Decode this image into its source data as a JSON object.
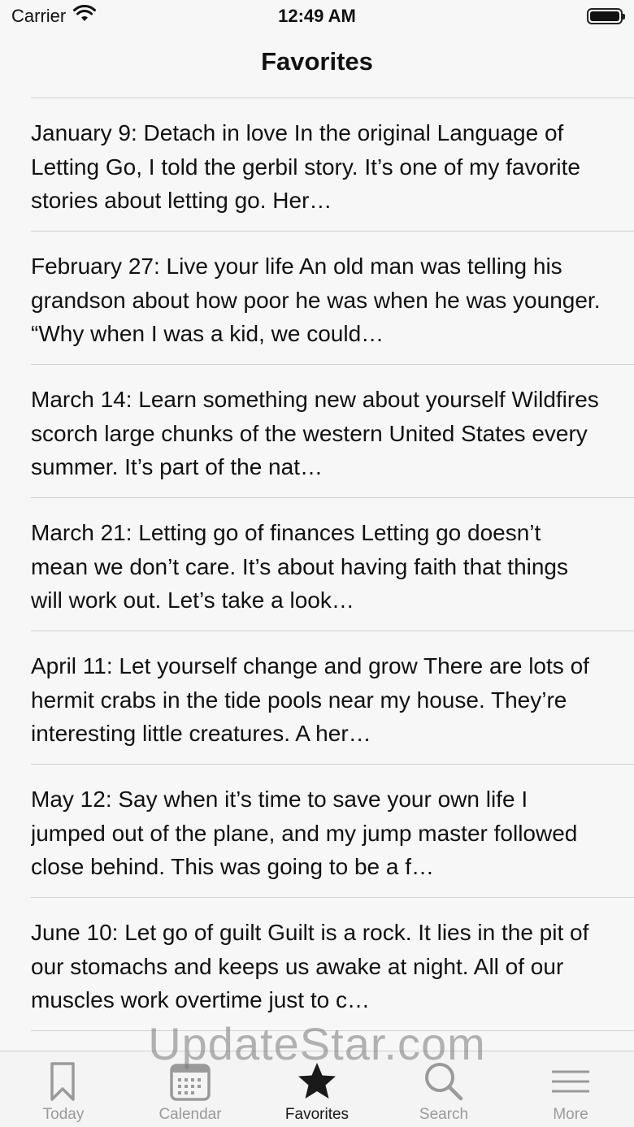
{
  "status": {
    "carrier": "Carrier",
    "time": "12:49 AM"
  },
  "nav": {
    "title": "Favorites"
  },
  "favorites": [
    {
      "text": "January 9:  Detach in love In the original Language of Letting Go, I told the gerbil story. It’s one of my favorite stories about letting go. Her…"
    },
    {
      "text": "February 27:  Live your life An old man was telling his grandson about how poor he was when he was younger. “Why when I was a kid, we could…"
    },
    {
      "text": "March 14:  Learn something new about yourself Wildfires scorch large chunks of the western United States every summer. It’s part of the nat…"
    },
    {
      "text": "March 21:  Letting go of finances Letting go doesn’t mean we don’t care. It’s about having faith that things will work out. Let’s take a look…"
    },
    {
      "text": "April 11:  Let yourself change and grow There are lots of hermit crabs in the tide pools near my house. They’re interesting little creatures. A her…"
    },
    {
      "text": "May 12:  Say when it’s time to save your own life I jumped out of the plane, and my jump master followed close behind. This was going to be a f…"
    },
    {
      "text": "June 10:  Let go of guilt Guilt is a rock. It lies in the pit of our stomachs and keeps us awake at night. All of our muscles work overtime just to c…"
    }
  ],
  "watermark": "UpdateStar.com",
  "tabs": [
    {
      "label": "Today",
      "icon": "bookmark-icon"
    },
    {
      "label": "Calendar",
      "icon": "calendar-icon"
    },
    {
      "label": "Favorites",
      "icon": "star-icon",
      "active": true
    },
    {
      "label": "Search",
      "icon": "search-icon"
    },
    {
      "label": "More",
      "icon": "menu-icon"
    }
  ],
  "colors": {
    "background": "#f7f7f7",
    "active_tab": "#1a1a1a",
    "inactive_tab": "#9a9a9a",
    "separator": "#d2d2d2"
  }
}
